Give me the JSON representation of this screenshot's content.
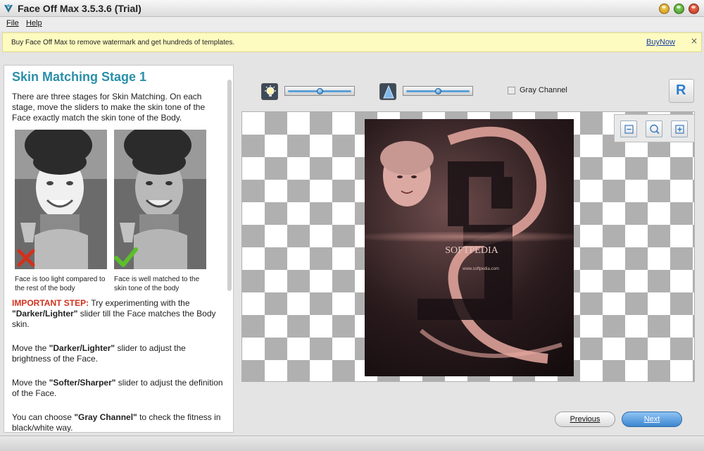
{
  "window": {
    "title": "Face Off Max  3.5.3.6  (Trial)",
    "icon": "app-logo-icon"
  },
  "menu": [
    "File",
    "Help"
  ],
  "banner": {
    "text": "Buy Face Off Max to remove watermark and get hundreds of templates.",
    "link": "BuyNow",
    "close": "×"
  },
  "left": {
    "heading": "Skin Matching Stage 1",
    "intro": "There are three stages for Skin Matching. On each stage, move the sliders to make the skin tone of the Face exactly match the skin tone of the Body.",
    "captions": [
      "Face is too light compared to the rest of the body",
      "Face is well matched to the skin tone of the body"
    ],
    "important_label": "IMPORTANT STEP:",
    "important_text_1": "Try experimenting with the",
    "important_bold": "\"Darker/Lighter\"",
    "important_text_2": "slider till the Face matches the Body skin.",
    "p2_a": "Move the",
    "p2_b": "\"Darker/Lighter\"",
    "p2_c": "slider to adjust the brightness of the Face.",
    "p3_a": "Move the",
    "p3_b": "\"Softer/Sharper\"",
    "p3_c": "slider to adjust the definition of the Face.",
    "p4_a": "You can choose",
    "p4_b": "\"Gray Channel\"",
    "p4_c": "to check the fitness in black/white way."
  },
  "toolbar": {
    "brightness_icon": "lightbulb-icon",
    "sharpness_icon": "sharpness-cone-icon",
    "brightness_value": 0.5,
    "sharpness_value": 0.5,
    "gray_channel_label": "Gray Channel",
    "gray_channel_checked": false,
    "r_button": "R"
  },
  "canvas": {
    "watermark": "SOFTPEDIA",
    "watermark_sub": "www.softpedia.com"
  },
  "zoom": [
    "zoom-out-icon",
    "zoom-fit-icon",
    "zoom-in-icon"
  ],
  "nav": {
    "previous": "Previous",
    "next": "Next"
  },
  "colors": {
    "accent": "#2b8fa8",
    "important": "#d2311d",
    "link": "#1a3ea8",
    "banner_bg": "#fdfbc0",
    "next_button": "#3d86cf",
    "poster_tint": "#e8a9a0"
  }
}
